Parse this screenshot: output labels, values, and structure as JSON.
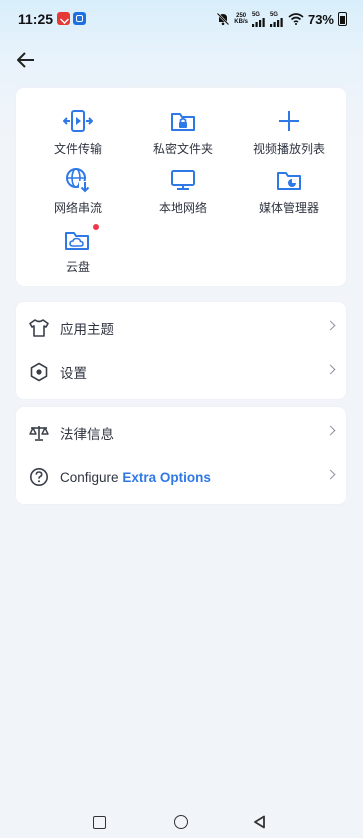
{
  "status_bar": {
    "time": "11:25",
    "net_speed_value": "250",
    "net_speed_unit": "KB/s",
    "sim1": "5G",
    "sim2": "5G",
    "battery": "73%"
  },
  "accent_color": "#2f79e6",
  "tools": [
    {
      "label": "文件传输",
      "icon": "file-transfer-icon"
    },
    {
      "label": "私密文件夹",
      "icon": "private-folder-icon"
    },
    {
      "label": "视频播放列表",
      "icon": "plus-icon"
    },
    {
      "label": "网络串流",
      "icon": "network-stream-icon"
    },
    {
      "label": "本地网络",
      "icon": "local-network-icon"
    },
    {
      "label": "媒体管理器",
      "icon": "media-manager-icon"
    },
    {
      "label": "云盘",
      "icon": "cloud-drive-icon"
    }
  ],
  "settings": {
    "theme": "应用主题",
    "settings": "设置"
  },
  "info": {
    "legal": "法律信息",
    "configure_prefix": "Configure",
    "configure_accent": "Extra Options"
  }
}
